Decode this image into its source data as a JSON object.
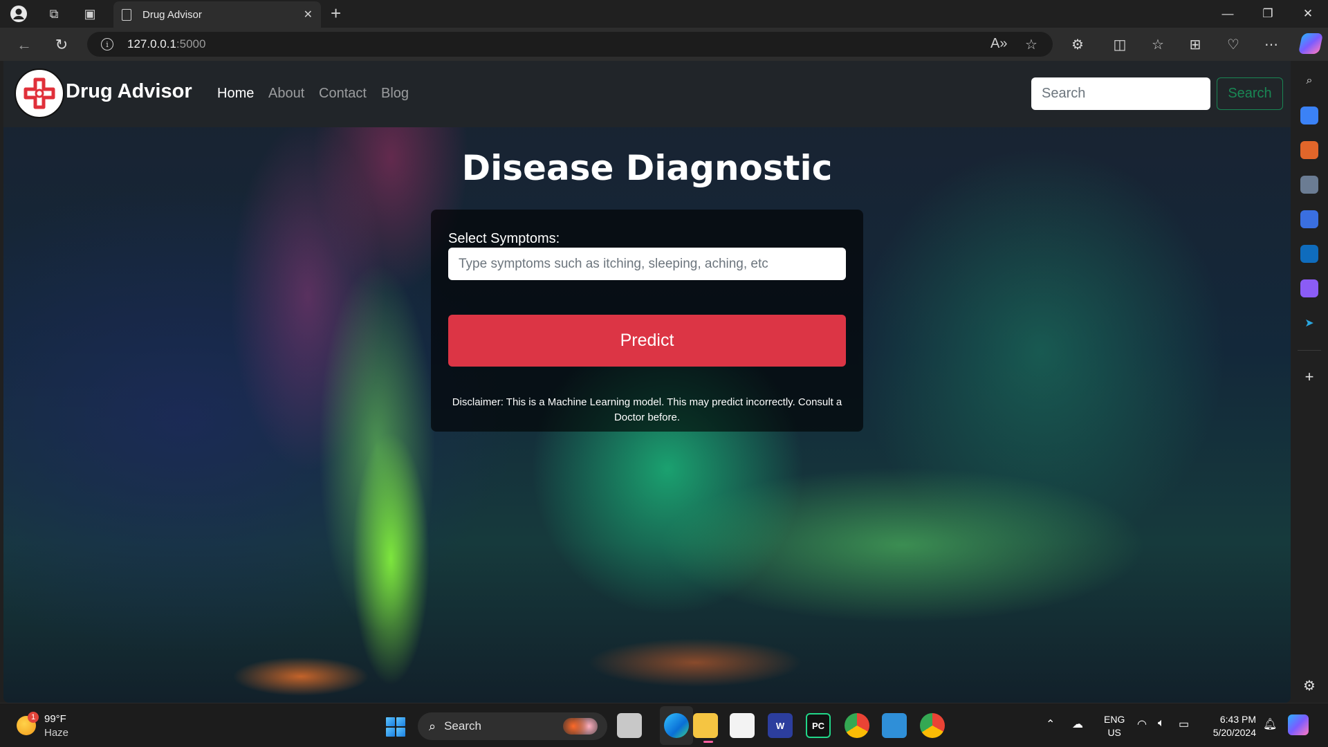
{
  "browser": {
    "tab_title": "Drug Advisor",
    "url_host": "127.0.0.1",
    "url_port": ":5000"
  },
  "site": {
    "brand": "Drug Advisor",
    "nav": [
      {
        "label": "Home",
        "active": true
      },
      {
        "label": "About",
        "active": false
      },
      {
        "label": "Contact",
        "active": false
      },
      {
        "label": "Blog",
        "active": false
      }
    ],
    "search_placeholder": "Search",
    "search_button": "Search"
  },
  "main": {
    "heading": "Disease Diagnostic",
    "symptoms_label": "Select Symptoms:",
    "symptoms_placeholder": "Type symptoms such as itching, sleeping, aching, etc",
    "predict_button": "Predict",
    "disclaimer": "Disclaimer: This is a Machine Learning model. This may predict incorrectly. Consult a Doctor before."
  },
  "taskbar": {
    "weather_temp": "99°F",
    "weather_condition": "Haze",
    "weather_badge": "1",
    "search_label": "Search",
    "lang_top": "ENG",
    "lang_bottom": "US",
    "time": "6:43 PM",
    "date": "5/20/2024"
  },
  "colors": {
    "predict": "#dc3545",
    "search_outline": "#198754",
    "navbar": "#212529"
  }
}
